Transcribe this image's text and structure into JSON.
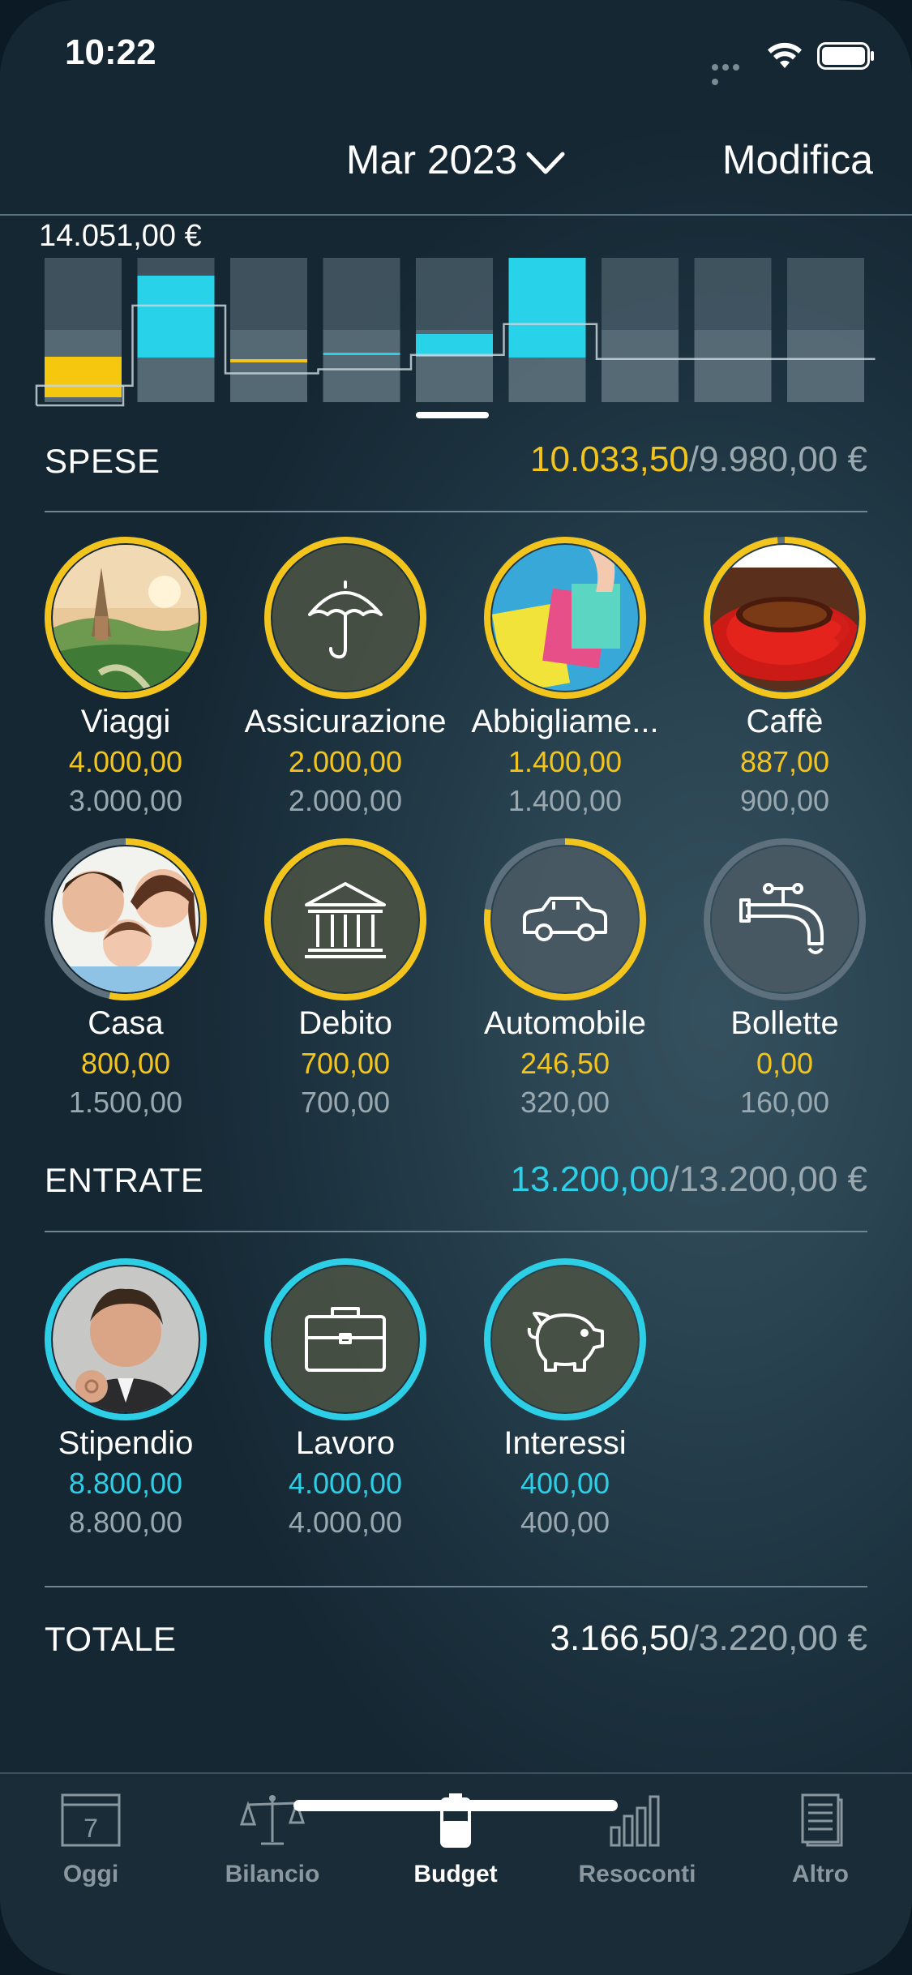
{
  "status": {
    "time": "10:22"
  },
  "header": {
    "month": "Mar 2023",
    "edit_label": "Modifica"
  },
  "chart": {
    "max_label": "14.051,00 €"
  },
  "chart_data": {
    "type": "bar",
    "max": 14051,
    "expenses": [
      2000,
      11000,
      200,
      300,
      1500,
      10000,
      0,
      0,
      0
    ],
    "cumulative_line": [
      1600,
      9400,
      2800,
      3200,
      4600,
      7600,
      4200,
      4200,
      4200
    ]
  },
  "expenses": {
    "label": "SPESE",
    "value": "10.033,50",
    "budget": "/9.980,00 €",
    "items": [
      {
        "name": "Viaggi",
        "spent": "4.000,00",
        "budget": "3.000,00",
        "kind": "photo",
        "progress": 1,
        "icon": "travel-photo"
      },
      {
        "name": "Assicurazione",
        "spent": "2.000,00",
        "budget": "2.000,00",
        "kind": "icon",
        "progress": 1,
        "icon": "umbrella-icon"
      },
      {
        "name": "Abbigliame...",
        "spent": "1.400,00",
        "budget": "1.400,00",
        "kind": "photo",
        "progress": 1,
        "icon": "shopping-photo"
      },
      {
        "name": "Caffè",
        "spent": "887,00",
        "budget": "900,00",
        "kind": "photo",
        "progress": 0.985,
        "icon": "coffee-photo"
      },
      {
        "name": "Casa",
        "spent": "800,00",
        "budget": "1.500,00",
        "kind": "photo",
        "progress": 0.533,
        "icon": "family-photo"
      },
      {
        "name": "Debito",
        "spent": "700,00",
        "budget": "700,00",
        "kind": "icon",
        "progress": 1,
        "icon": "bank-icon"
      },
      {
        "name": "Automobile",
        "spent": "246,50",
        "budget": "320,00",
        "kind": "icon",
        "progress": 0.77,
        "icon": "car-icon"
      },
      {
        "name": "Bollette",
        "spent": "0,00",
        "budget": "160,00",
        "kind": "icon",
        "progress": 0,
        "icon": "faucet-icon"
      }
    ]
  },
  "income": {
    "label": "ENTRATE",
    "value": "13.200,00",
    "budget": "/13.200,00 €",
    "items": [
      {
        "name": "Stipendio",
        "earned": "8.800,00",
        "budget": "8.800,00",
        "kind": "photo",
        "progress": 1,
        "icon": "man-photo"
      },
      {
        "name": "Lavoro",
        "earned": "4.000,00",
        "budget": "4.000,00",
        "kind": "icon",
        "progress": 1,
        "icon": "briefcase-icon"
      },
      {
        "name": "Interessi",
        "earned": "400,00",
        "budget": "400,00",
        "kind": "icon",
        "progress": 1,
        "icon": "piggy-bank-icon"
      }
    ]
  },
  "total": {
    "label": "TOTALE",
    "value": "3.166,50",
    "budget": "/3.220,00 €"
  },
  "tabs": [
    {
      "label": "Oggi",
      "icon": "calendar-icon"
    },
    {
      "label": "Bilancio",
      "icon": "scale-icon"
    },
    {
      "label": "Budget",
      "icon": "battery-icon",
      "active": true
    },
    {
      "label": "Resoconti",
      "icon": "bar-chart-icon"
    },
    {
      "label": "Altro",
      "icon": "document-icon"
    }
  ],
  "colors": {
    "accent_expense": "#f3c51c",
    "accent_income": "#2ccfe6",
    "track": "#5d707b"
  },
  "calendar_day": "7"
}
